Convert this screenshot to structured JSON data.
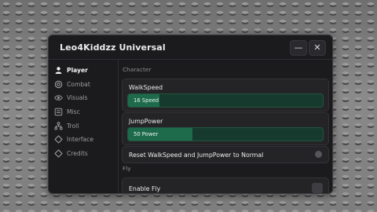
{
  "window": {
    "title": "Leo4Kiddzz Universal"
  },
  "titlebar": {
    "minimize_glyph": "—",
    "close_glyph": "✕"
  },
  "sidebar": {
    "items": [
      {
        "label": "Player",
        "icon": "user-icon",
        "active": true
      },
      {
        "label": "Combat",
        "icon": "target-icon"
      },
      {
        "label": "Visuals",
        "icon": "eye-icon"
      },
      {
        "label": "Misc",
        "icon": "list-icon"
      },
      {
        "label": "Troll",
        "icon": "network-icon"
      },
      {
        "label": "Interface",
        "icon": "diamond-icon"
      },
      {
        "label": "Credits",
        "icon": "diamond-icon"
      }
    ],
    "avatar": "avatar"
  },
  "content": {
    "sections": {
      "character": "Character",
      "fly": "Fly"
    },
    "walkspeed": {
      "label": "WalkSpeed",
      "value_text": "16 Speed",
      "fill_fraction": 0.16
    },
    "jumppower": {
      "label": "JumpPower",
      "value_text": "50 Power",
      "fill_fraction": 0.33
    },
    "reset": {
      "label": "Reset WalkSpeed and JumpPower to Normal"
    },
    "enable_fly": {
      "label": "Enable Fly",
      "enabled": false
    }
  },
  "colors": {
    "window_bg": "#1b1b1d",
    "card_bg": "#242427",
    "slider_track": "#173a2e",
    "slider_fill": "#1e6b4c",
    "text": "#ececec",
    "muted_text": "#9c9c9c"
  }
}
